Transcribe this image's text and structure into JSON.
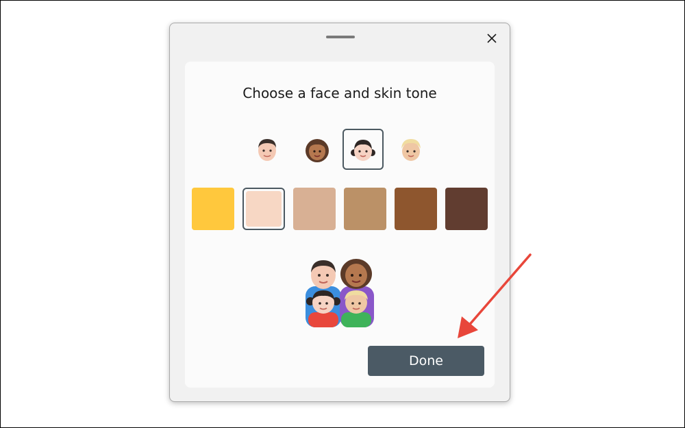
{
  "dialog": {
    "title": "Choose a face and skin tone",
    "done_label": "Done"
  },
  "faces": [
    {
      "name": "man",
      "selected": false
    },
    {
      "name": "woman",
      "selected": false
    },
    {
      "name": "girl",
      "selected": true
    },
    {
      "name": "boy",
      "selected": false
    }
  ],
  "skin_tones": [
    {
      "color": "#ffc83d",
      "selected": false
    },
    {
      "color": "#f7d7c4",
      "selected": true
    },
    {
      "color": "#d8b094",
      "selected": false
    },
    {
      "color": "#bb9167",
      "selected": false
    },
    {
      "color": "#8e562e",
      "selected": false
    },
    {
      "color": "#613d30",
      "selected": false
    }
  ],
  "colors": {
    "accent": "#4b5a65",
    "arrow": "#e8463a"
  },
  "icons": {
    "close": "close-icon",
    "preview": "family-emoji-icon"
  }
}
